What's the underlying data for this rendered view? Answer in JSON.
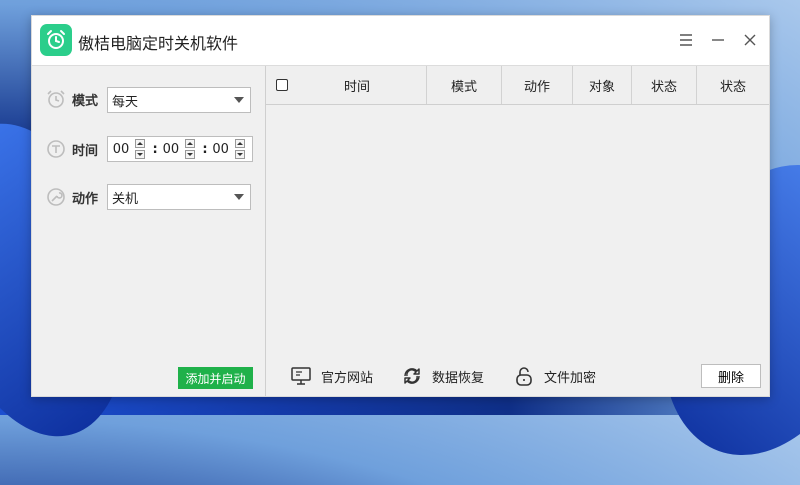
{
  "app": {
    "title": "傲桔电脑定时关机软件"
  },
  "window_controls": {
    "menu_icon": "menu-icon",
    "minimize_icon": "minimize-icon",
    "close_icon": "close-icon"
  },
  "form": {
    "mode": {
      "label": "模式",
      "value": "每天",
      "icon": "alarm-clock-icon"
    },
    "time": {
      "label": "时间",
      "hours": "00",
      "minutes": "00",
      "seconds": "00",
      "icon": "timer-icon"
    },
    "action": {
      "label": "动作",
      "value": "关机",
      "icon": "wrench-icon"
    },
    "submit_label": "添加并启动"
  },
  "table": {
    "columns": [
      "时间",
      "模式",
      "动作",
      "对象",
      "状态",
      "状态"
    ]
  },
  "bottom": {
    "website": {
      "label": "官方网站",
      "icon": "monitor-icon"
    },
    "recover": {
      "label": "数据恢复",
      "icon": "refresh-icon"
    },
    "encrypt": {
      "label": "文件加密",
      "icon": "lock-icon"
    },
    "delete_label": "删除"
  },
  "colors": {
    "accent_green": "#1fb14a",
    "logo_green": "#2bce8b"
  }
}
